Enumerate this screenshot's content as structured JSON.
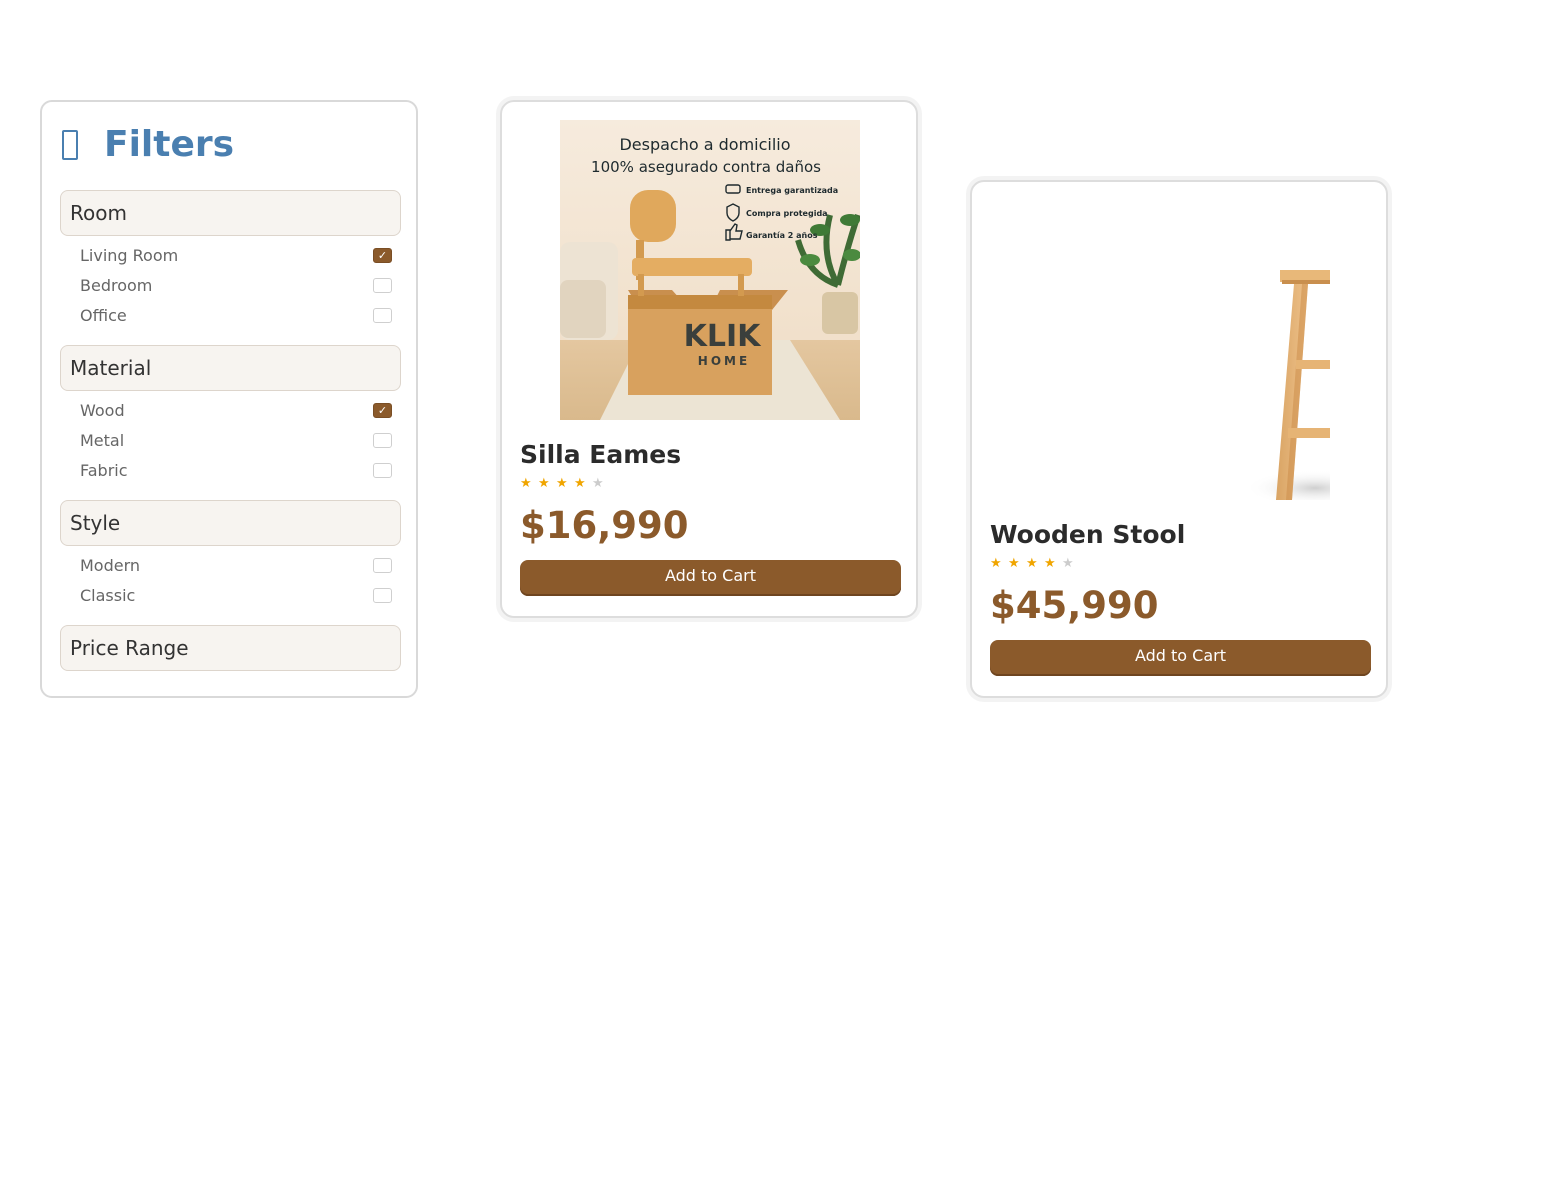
{
  "filters": {
    "icon": "filter-icon",
    "title": "Filters",
    "groups": [
      {
        "label": "Room",
        "options": [
          {
            "label": "Living Room",
            "checked": true
          },
          {
            "label": "Bedroom",
            "checked": false
          },
          {
            "label": "Office",
            "checked": false
          }
        ]
      },
      {
        "label": "Material",
        "options": [
          {
            "label": "Wood",
            "checked": true
          },
          {
            "label": "Metal",
            "checked": false
          },
          {
            "label": "Fabric",
            "checked": false
          }
        ]
      },
      {
        "label": "Style",
        "options": [
          {
            "label": "Modern",
            "checked": false
          },
          {
            "label": "Classic",
            "checked": false
          }
        ]
      },
      {
        "label": "Price Range",
        "options": []
      }
    ]
  },
  "products": [
    {
      "name": "Silla Eames",
      "rating": 4,
      "rating_max": 5,
      "price": "$16,990",
      "cart_label": "Add to Cart",
      "image": {
        "headline_1": "Despacho a domicilio",
        "headline_2": "100% asegurado contra daños",
        "features": [
          "Entrega garantizada",
          "Compra protegida",
          "Garantía 2 años"
        ],
        "box_brand": "KLIK",
        "box_sub": "HOME"
      }
    },
    {
      "name": "Wooden Stool",
      "rating": 4,
      "rating_max": 5,
      "price": "$45,990",
      "cart_label": "Add to Cart"
    }
  ],
  "colors": {
    "accent": "#8b5a2b",
    "title_blue": "#4a7fb0",
    "star": "#f0a500"
  }
}
